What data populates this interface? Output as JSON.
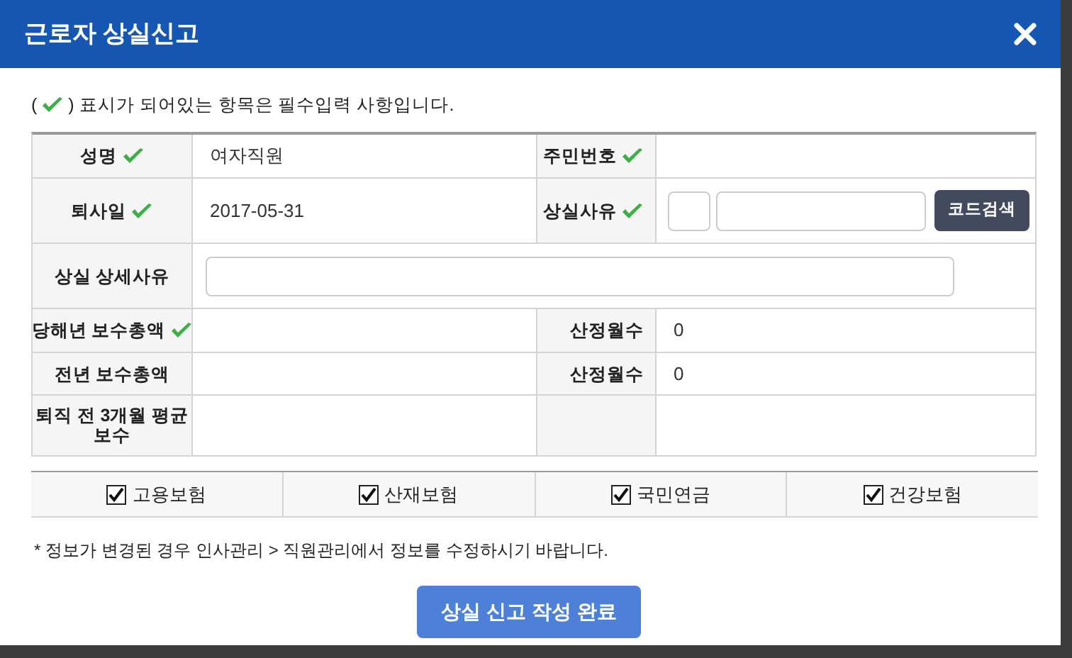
{
  "window": {
    "title": "근로자 상실신고"
  },
  "note": {
    "prefix": "(",
    "text": ") 표시가 되어있는 항목은 필수입력 사항입니다."
  },
  "rows": [
    [
      {
        "kind": "text",
        "label": "성명",
        "required": true,
        "value": "여자직원"
      },
      {
        "kind": "text",
        "label": "주민번호",
        "required": true
      }
    ],
    [
      {
        "kind": "text",
        "label": "퇴사일",
        "required": true,
        "value": "2017-05-31"
      },
      {
        "kind": "code_search",
        "label": "상실사유",
        "required": true,
        "button": "코드검색"
      }
    ],
    [
      {
        "kind": "wide_input",
        "label": "상실 상세사유",
        "required": false
      }
    ],
    [
      {
        "kind": "text",
        "label": "당해년 보수총액",
        "required": true
      },
      {
        "kind": "text",
        "label": "산정월수",
        "required": false,
        "value": "0"
      }
    ],
    [
      {
        "kind": "text",
        "label": "전년 보수총액",
        "required": false
      },
      {
        "kind": "text",
        "label": "산정월수",
        "required": false,
        "value": "0"
      }
    ],
    [
      {
        "kind": "text",
        "label": "퇴직 전 3개월 평균 보수",
        "required": false
      },
      {
        "kind": "empty"
      }
    ]
  ],
  "insurance": [
    {
      "label": "고용보험",
      "checked": true
    },
    {
      "label": "산재보험",
      "checked": true
    },
    {
      "label": "국민연금",
      "checked": true
    },
    {
      "label": "건강보험",
      "checked": true
    }
  ],
  "footnote": "* 정보가 변경된 경우 인사관리 > 직원관리에서 정보를 수정하시기 바랍니다.",
  "submit": "상실 신고 작성 완료"
}
